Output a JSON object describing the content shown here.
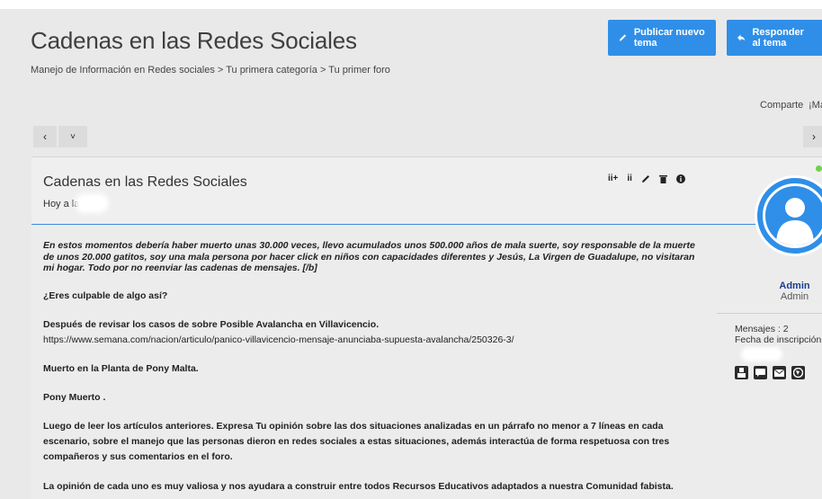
{
  "header": {
    "title": "Cadenas en las Redes Sociales",
    "breadcrumb": [
      "Manejo de Información en Redes sociales",
      "Tu primera categoría",
      "Tu primer foro"
    ],
    "breadcrumb_separator": ">",
    "new_topic_label": "Publicar nuevo tema",
    "reply_label": "Responder al tema"
  },
  "share": {
    "share_label": "Comparte",
    "more_label": "¡Má"
  },
  "nav": {
    "prev": "‹",
    "collapse": "˅",
    "next": "›"
  },
  "post": {
    "title": "Cadenas en las Redes Sociales",
    "date_prefix": "Hoy a las",
    "tools": [
      "ii+",
      "ii",
      "pencil-icon",
      "trash-icon",
      "info-icon"
    ],
    "paragraphs": [
      "En estos momentos debería haber muerto unas 30.000 veces, llevo acumulados unos 500.000 años de mala suerte, soy responsable de la muerte de unos 20.000 gatitos, soy una mala persona por hacer click en niños con capacidades diferentes y Jesús, La Virgen de Guadalupe, no visitaran mi hogar. Todo por no reenviar las cadenas de mensajes. [/b]",
      "¿Eres culpable de algo así?",
      "Después de revisar los casos de sobre Posible Avalancha en Villavicencio.",
      "https://www.semana.com/nacion/articulo/panico-villavicencio-mensaje-anunciaba-supuesta-avalancha/250326-3/",
      "Muerto en la Planta de Pony Malta.",
      "Pony Muerto .",
      "Luego de leer los artículos anteriores. Expresa Tu opinión sobre las dos situaciones analizadas en un párrafo no menor a 7 líneas en cada escenario, sobre el manejo que las personas dieron en redes sociales a estas situaciones, además interactúa de forma respetuosa con tres compañeros y sus comentarios en el foro.",
      "La opinión de cada uno es muy valiosa y nos ayudara a construir entre todos Recursos Educativos adaptados a nuestra Comunidad fabista."
    ]
  },
  "author": {
    "name": "Admin",
    "rank": "Admin",
    "posts_label": "Mensajes : 2",
    "joined_label": "Fecha de inscripción :",
    "contact_icons": [
      "profile-icon",
      "chat-icon",
      "mail-icon",
      "website-icon"
    ]
  },
  "colors": {
    "accent": "#2f8fe8",
    "online": "#6dd24a"
  }
}
